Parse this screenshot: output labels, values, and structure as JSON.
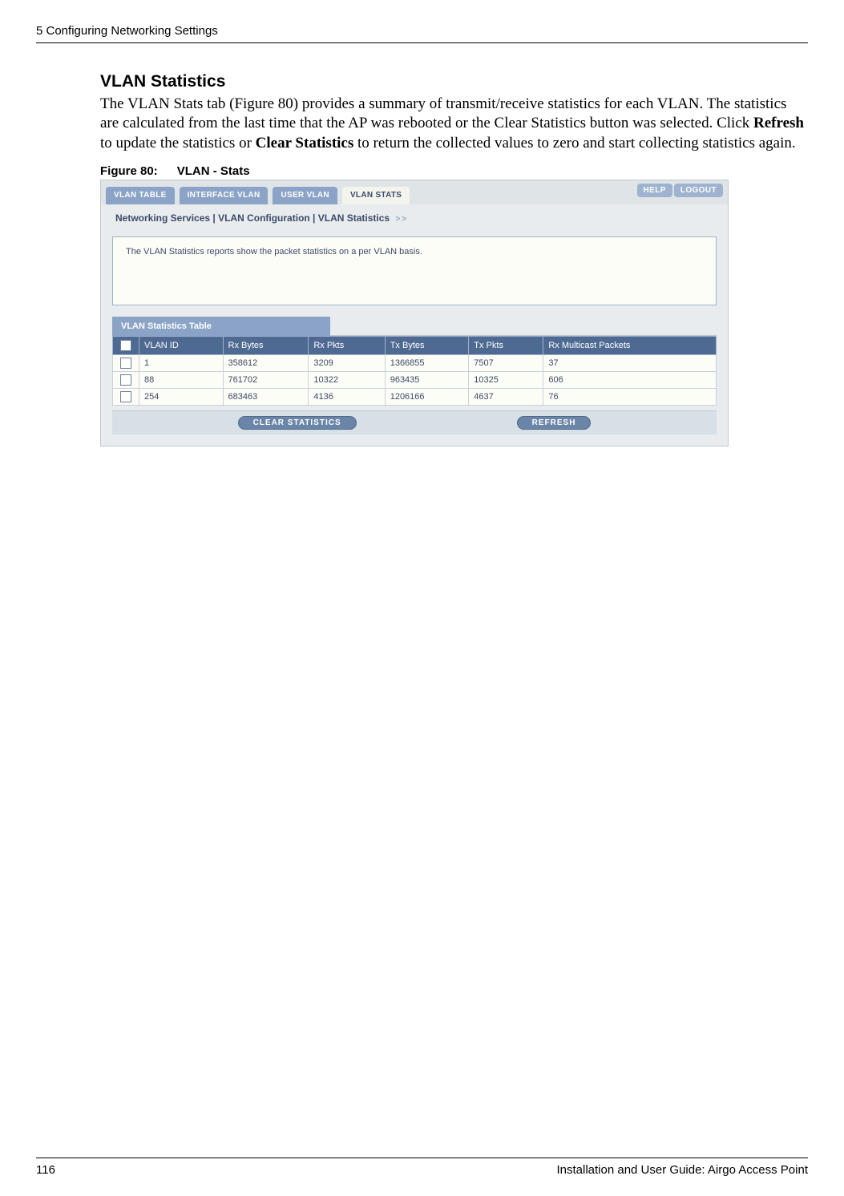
{
  "header": {
    "running": "5  Configuring Networking Settings"
  },
  "section": {
    "title": "VLAN Statistics",
    "para_pre": "The VLAN Stats tab (Figure 80) provides a summary of transmit/receive statistics for each VLAN. The statistics are calculated from the last time that the AP was rebooted or the Clear Statistics button was selected. Click ",
    "bold1": "Refresh",
    "mid1": " to update the statistics or ",
    "bold2": "Clear Statistics",
    "mid2": " to return the collected values to zero and start collecting statistics again."
  },
  "figure": {
    "label": "Figure 80:",
    "title": "VLAN - Stats"
  },
  "ui": {
    "tabs": {
      "vlan_table": "VLAN TABLE",
      "interface_vlan": "INTERFACE VLAN",
      "user_vlan": "USER VLAN",
      "vlan_stats": "VLAN STATS"
    },
    "top_buttons": {
      "help": "HELP",
      "logout": "LOGOUT"
    },
    "breadcrumb": "Networking Services | VLAN Configuration | VLAN Statistics",
    "breadcrumb_arrows": ">>",
    "panel_text": "The VLAN Statistics reports show the packet statistics on a per VLAN basis.",
    "stats_table_title": "VLAN Statistics Table",
    "columns": {
      "vlan_id": "VLAN ID",
      "rx_bytes": "Rx Bytes",
      "rx_pkts": "Rx Pkts",
      "tx_bytes": "Tx Bytes",
      "tx_pkts": "Tx Pkts",
      "rx_mcast": "Rx Multicast Packets"
    },
    "rows": [
      {
        "vlan_id": "1",
        "rx_bytes": "358612",
        "rx_pkts": "3209",
        "tx_bytes": "1366855",
        "tx_pkts": "7507",
        "rx_mcast": "37"
      },
      {
        "vlan_id": "88",
        "rx_bytes": "761702",
        "rx_pkts": "10322",
        "tx_bytes": "963435",
        "tx_pkts": "10325",
        "rx_mcast": "606"
      },
      {
        "vlan_id": "254",
        "rx_bytes": "683463",
        "rx_pkts": "4136",
        "tx_bytes": "1206166",
        "tx_pkts": "4637",
        "rx_mcast": "76"
      }
    ],
    "buttons": {
      "clear": "CLEAR STATISTICS",
      "refresh": "REFRESH"
    }
  },
  "footer": {
    "page": "116",
    "doc": "Installation and User Guide: Airgo Access Point"
  }
}
